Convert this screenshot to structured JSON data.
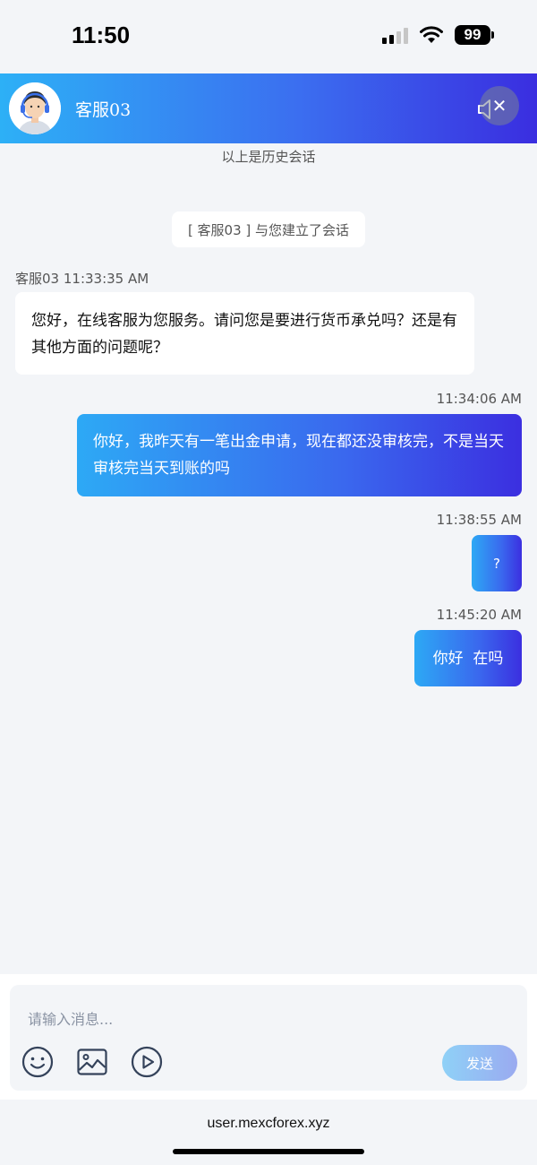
{
  "status_bar": {
    "time": "11:50",
    "battery": "99"
  },
  "header": {
    "agent_name": "客服03",
    "avatar_icon": "agent-headset-avatar",
    "speaker_icon": "speaker-muted-icon",
    "close_icon": "close-icon"
  },
  "chat": {
    "history_note": "以上是历史会话",
    "system_message": "[ 客服03 ] 与您建立了会话",
    "messages": [
      {
        "sender": "agent",
        "meta": "客服03 11:33:35 AM",
        "text": "您好，在线客服为您服务。请问您是要进行货币承兑吗？还是有其他方面的问题呢？"
      },
      {
        "sender": "user",
        "meta": "11:34:06 AM",
        "text": "你好，我昨天有一笔出金申请，现在都还没审核完，不是当天审核完当天到账的吗"
      },
      {
        "sender": "user",
        "meta": "11:38:55 AM",
        "text": "?"
      },
      {
        "sender": "user",
        "meta": "11:45:20 AM",
        "text": "你好  在吗"
      }
    ]
  },
  "composer": {
    "placeholder": "请输入消息...",
    "tools": [
      "emoji-icon",
      "image-icon",
      "video-icon"
    ],
    "send_label": "发送"
  },
  "browser": {
    "url": "user.mexcforex.xyz"
  },
  "colors": {
    "accent_start": "#2db0f6",
    "accent_end": "#3a2ee0",
    "background": "#f3f5f8"
  }
}
